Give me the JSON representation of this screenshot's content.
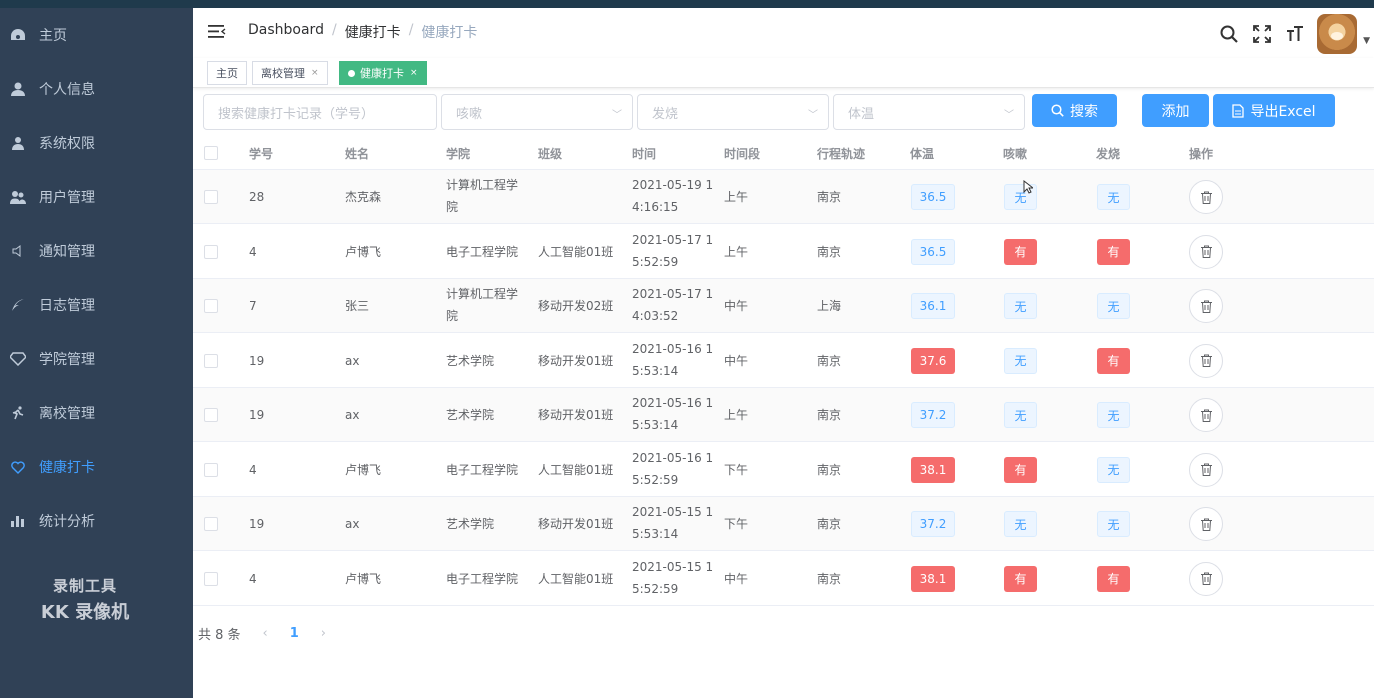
{
  "sidebar": {
    "items": [
      {
        "label": "主页",
        "icon": "dashboard-icon"
      },
      {
        "label": "个人信息",
        "icon": "user-icon"
      },
      {
        "label": "系统权限",
        "icon": "permission-icon"
      },
      {
        "label": "用户管理",
        "icon": "users-icon"
      },
      {
        "label": "通知管理",
        "icon": "speaker-icon"
      },
      {
        "label": "日志管理",
        "icon": "feather-icon"
      },
      {
        "label": "学院管理",
        "icon": "diamond-icon"
      },
      {
        "label": "离校管理",
        "icon": "running-icon"
      },
      {
        "label": "健康打卡",
        "icon": "heart-icon",
        "active": true
      },
      {
        "label": "统计分析",
        "icon": "bar-chart-icon"
      }
    ],
    "watermark_line1": "录制工具",
    "watermark_line2": "KK 录像机"
  },
  "breadcrumb": {
    "root": "Dashboard",
    "parent": "健康打卡",
    "current": "健康打卡"
  },
  "tags": [
    {
      "label": "主页"
    },
    {
      "label": "离校管理",
      "close": "×"
    },
    {
      "label": "健康打卡",
      "close": "×",
      "active": true
    }
  ],
  "filters": {
    "search_placeholder": "搜索健康打卡记录（学号）",
    "cough_placeholder": "咳嗽",
    "fever_placeholder": "发烧",
    "temp_placeholder": "体温"
  },
  "buttons": {
    "search": "搜索",
    "add": "添加",
    "export": "导出Excel"
  },
  "table": {
    "headers": [
      "学号",
      "姓名",
      "学院",
      "班级",
      "时间",
      "时间段",
      "行程轨迹",
      "体温",
      "咳嗽",
      "发烧",
      "操作"
    ],
    "rows": [
      {
        "id": "28",
        "name": "杰克森",
        "college": "计算机工程学院",
        "college_l1": "计算机工程学",
        "college_l2": "院",
        "class": "",
        "time_l1": "2021-05-19 1",
        "time_l2": "4:16:15",
        "period": "上午",
        "trip": "南京",
        "temp": "36.5",
        "temp_high": false,
        "cough": "无",
        "fever": "无"
      },
      {
        "id": "4",
        "name": "卢博飞",
        "college_l1": "电子工程学院",
        "college_l2": "",
        "class": "人工智能01班",
        "time_l1": "2021-05-17 1",
        "time_l2": "5:52:59",
        "period": "上午",
        "trip": "南京",
        "temp": "36.5",
        "temp_high": false,
        "cough": "有",
        "fever": "有"
      },
      {
        "id": "7",
        "name": "张三",
        "college_l1": "计算机工程学",
        "college_l2": "院",
        "class": "移动开发02班",
        "time_l1": "2021-05-17 1",
        "time_l2": "4:03:52",
        "period": "中午",
        "trip": "上海",
        "temp": "36.1",
        "temp_high": false,
        "cough": "无",
        "fever": "无"
      },
      {
        "id": "19",
        "name": "ax",
        "college_l1": "艺术学院",
        "college_l2": "",
        "class": "移动开发01班",
        "time_l1": "2021-05-16 1",
        "time_l2": "5:53:14",
        "period": "中午",
        "trip": "南京",
        "temp": "37.6",
        "temp_high": true,
        "cough": "无",
        "fever": "有"
      },
      {
        "id": "19",
        "name": "ax",
        "college_l1": "艺术学院",
        "college_l2": "",
        "class": "移动开发01班",
        "time_l1": "2021-05-16 1",
        "time_l2": "5:53:14",
        "period": "上午",
        "trip": "南京",
        "temp": "37.2",
        "temp_high": false,
        "cough": "无",
        "fever": "无"
      },
      {
        "id": "4",
        "name": "卢博飞",
        "college_l1": "电子工程学院",
        "college_l2": "",
        "class": "人工智能01班",
        "time_l1": "2021-05-16 1",
        "time_l2": "5:52:59",
        "period": "下午",
        "trip": "南京",
        "temp": "38.1",
        "temp_high": true,
        "cough": "有",
        "fever": "无"
      },
      {
        "id": "19",
        "name": "ax",
        "college_l1": "艺术学院",
        "college_l2": "",
        "class": "移动开发01班",
        "time_l1": "2021-05-15 1",
        "time_l2": "5:53:14",
        "period": "下午",
        "trip": "南京",
        "temp": "37.2",
        "temp_high": false,
        "cough": "无",
        "fever": "无"
      },
      {
        "id": "4",
        "name": "卢博飞",
        "college_l1": "电子工程学院",
        "college_l2": "",
        "class": "人工智能01班",
        "time_l1": "2021-05-15 1",
        "time_l2": "5:52:59",
        "period": "中午",
        "trip": "南京",
        "temp": "38.1",
        "temp_high": true,
        "cough": "有",
        "fever": "有"
      }
    ]
  },
  "pagination": {
    "total": "共 8 条",
    "prev": "‹",
    "current": "1",
    "next": "›"
  },
  "colors": {
    "sidebar_bg": "#304156",
    "accent": "#409eff",
    "tag_active": "#42b983",
    "danger": "#f56c6c"
  }
}
